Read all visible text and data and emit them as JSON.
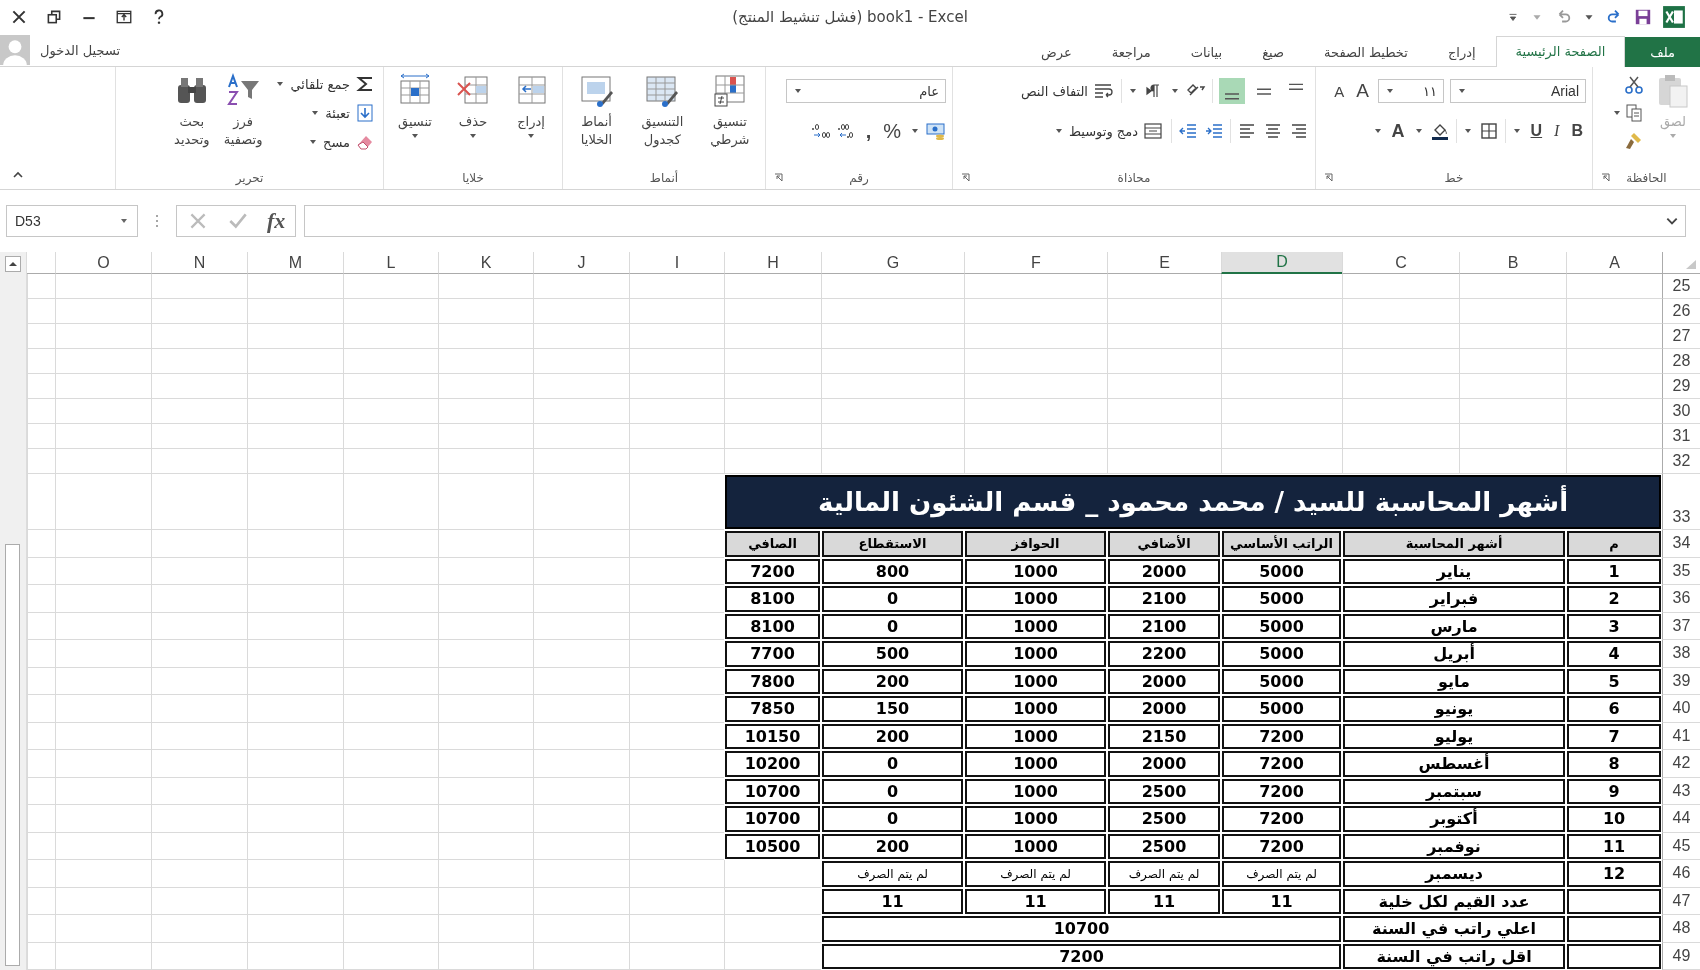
{
  "title_bar": {
    "title": "book1 - Excel (فشل تنشيط المنتج)"
  },
  "account": {
    "sign_in": "تسجيل الدخول"
  },
  "tabs": [
    {
      "label": "ملف",
      "kind": "file",
      "selected": false
    },
    {
      "label": "الصفحة الرئيسية",
      "kind": "tab",
      "selected": true
    },
    {
      "label": "إدراج",
      "kind": "tab",
      "selected": false
    },
    {
      "label": "تخطيط الصفحة",
      "kind": "tab",
      "selected": false
    },
    {
      "label": "صيغ",
      "kind": "tab",
      "selected": false
    },
    {
      "label": "بيانات",
      "kind": "tab",
      "selected": false
    },
    {
      "label": "مراجعة",
      "kind": "tab",
      "selected": false
    },
    {
      "label": "عرض",
      "kind": "tab",
      "selected": false
    }
  ],
  "ribbon": {
    "clipboard": {
      "label": "الحافظة",
      "paste": {
        "label": "لصق",
        "disabled": true
      }
    },
    "font": {
      "label": "خط",
      "font_name": "Arial",
      "font_size": "١١",
      "grow": "A",
      "shrink": "A",
      "bold": "B",
      "italic": "I",
      "underline": "U",
      "font_color": "A"
    },
    "alignment": {
      "label": "محاذاة",
      "vertical_align": [
        {
          "selected": false
        },
        {
          "selected": false
        },
        {
          "selected": true
        }
      ],
      "wrap_text": "التفاف النص",
      "merge_center": "دمج وتوسيط"
    },
    "number": {
      "label": "رقم",
      "format": "عام",
      "percent": "%",
      "comma": ","
    },
    "styles": {
      "label": "أنماط",
      "buttons": [
        {
          "lines": [
            "تنسيق",
            "شرطي"
          ]
        },
        {
          "lines": [
            "التنسيق",
            "كجدول"
          ]
        },
        {
          "lines": [
            "أنماط",
            "الخلايا"
          ]
        }
      ]
    },
    "cells": {
      "label": "خلايا",
      "buttons": [
        "إدراج",
        "حذف",
        "تنسيق"
      ]
    },
    "editing": {
      "label": "تحرير",
      "autosum": "جمع تلقائي",
      "fill": "تعبئة",
      "clear": "مسح",
      "sort": [
        "فرز",
        "وتصفية"
      ],
      "find": [
        "بحث",
        "وتحديد"
      ]
    }
  },
  "formula_bar": {
    "name_box": "D53",
    "function_label": "fx"
  },
  "sheet": {
    "column_headers": [
      {
        "label": "A",
        "selected": false
      },
      {
        "label": "B",
        "selected": false
      },
      {
        "label": "C",
        "selected": false
      },
      {
        "label": "D",
        "selected": true
      },
      {
        "label": "E",
        "selected": false
      },
      {
        "label": "F",
        "selected": false
      },
      {
        "label": "G",
        "selected": false
      },
      {
        "label": "H",
        "selected": false
      },
      {
        "label": "I",
        "selected": false
      },
      {
        "label": "J",
        "selected": false
      },
      {
        "label": "K",
        "selected": false
      },
      {
        "label": "L",
        "selected": false
      },
      {
        "label": "M",
        "selected": false
      },
      {
        "label": "N",
        "selected": false
      },
      {
        "label": "O",
        "selected": false
      }
    ],
    "empty_rows": [
      "25",
      "26",
      "27",
      "28",
      "29",
      "30",
      "31",
      "32"
    ],
    "title_row": {
      "number": "33",
      "text": "أشهر المحاسبة للسيد / محمد محمود _ قسم الشئون المالية"
    },
    "header_row": {
      "number": "34",
      "cells": [
        "م",
        "أشهر المحاسبة",
        "الراتب الأساسي",
        "الأضافي",
        "الحوافز",
        "الاستقطاع",
        "الصافي"
      ]
    },
    "data_rows": [
      {
        "number": "35",
        "cells": [
          "1",
          "يناير",
          "5000",
          "2000",
          "1000",
          "800",
          "7200"
        ]
      },
      {
        "number": "36",
        "cells": [
          "2",
          "فبراير",
          "5000",
          "2100",
          "1000",
          "0",
          "8100"
        ]
      },
      {
        "number": "37",
        "cells": [
          "3",
          "مارس",
          "5000",
          "2100",
          "1000",
          "0",
          "8100"
        ]
      },
      {
        "number": "38",
        "cells": [
          "4",
          "أبريل",
          "5000",
          "2200",
          "1000",
          "500",
          "7700"
        ]
      },
      {
        "number": "39",
        "cells": [
          "5",
          "مايو",
          "5000",
          "2000",
          "1000",
          "200",
          "7800"
        ]
      },
      {
        "number": "40",
        "cells": [
          "6",
          "يونيو",
          "5000",
          "2000",
          "1000",
          "150",
          "7850"
        ]
      },
      {
        "number": "41",
        "cells": [
          "7",
          "يوليو",
          "7200",
          "2150",
          "1000",
          "200",
          "10150"
        ]
      },
      {
        "number": "42",
        "cells": [
          "8",
          "أغسطس",
          "7200",
          "2000",
          "1000",
          "0",
          "10200"
        ]
      },
      {
        "number": "43",
        "cells": [
          "9",
          "سبتمبر",
          "7200",
          "2500",
          "1000",
          "0",
          "10700"
        ]
      },
      {
        "number": "44",
        "cells": [
          "10",
          "أكتوبر",
          "7200",
          "2500",
          "1000",
          "0",
          "10700"
        ]
      },
      {
        "number": "45",
        "cells": [
          "11",
          "نوفمبر",
          "7200",
          "2500",
          "1000",
          "200",
          "10500"
        ]
      }
    ],
    "unpaid_row": {
      "number": "46",
      "index": "12",
      "month": "ديسمبر",
      "values": [
        "لم يتم الصرف",
        "لم يتم الصرف",
        "لم يتم الصرف",
        "لم يتم الصرف"
      ]
    },
    "count_row": {
      "number": "47",
      "label": "عدد القيم لكل خلية",
      "values": [
        "11",
        "11",
        "11",
        "11"
      ]
    },
    "summary_rows": [
      {
        "number": "48",
        "label": "اعلي راتب في السنة",
        "value": "10700"
      },
      {
        "number": "49",
        "label": "اقل راتب في السنة",
        "value": "7200"
      }
    ]
  }
}
